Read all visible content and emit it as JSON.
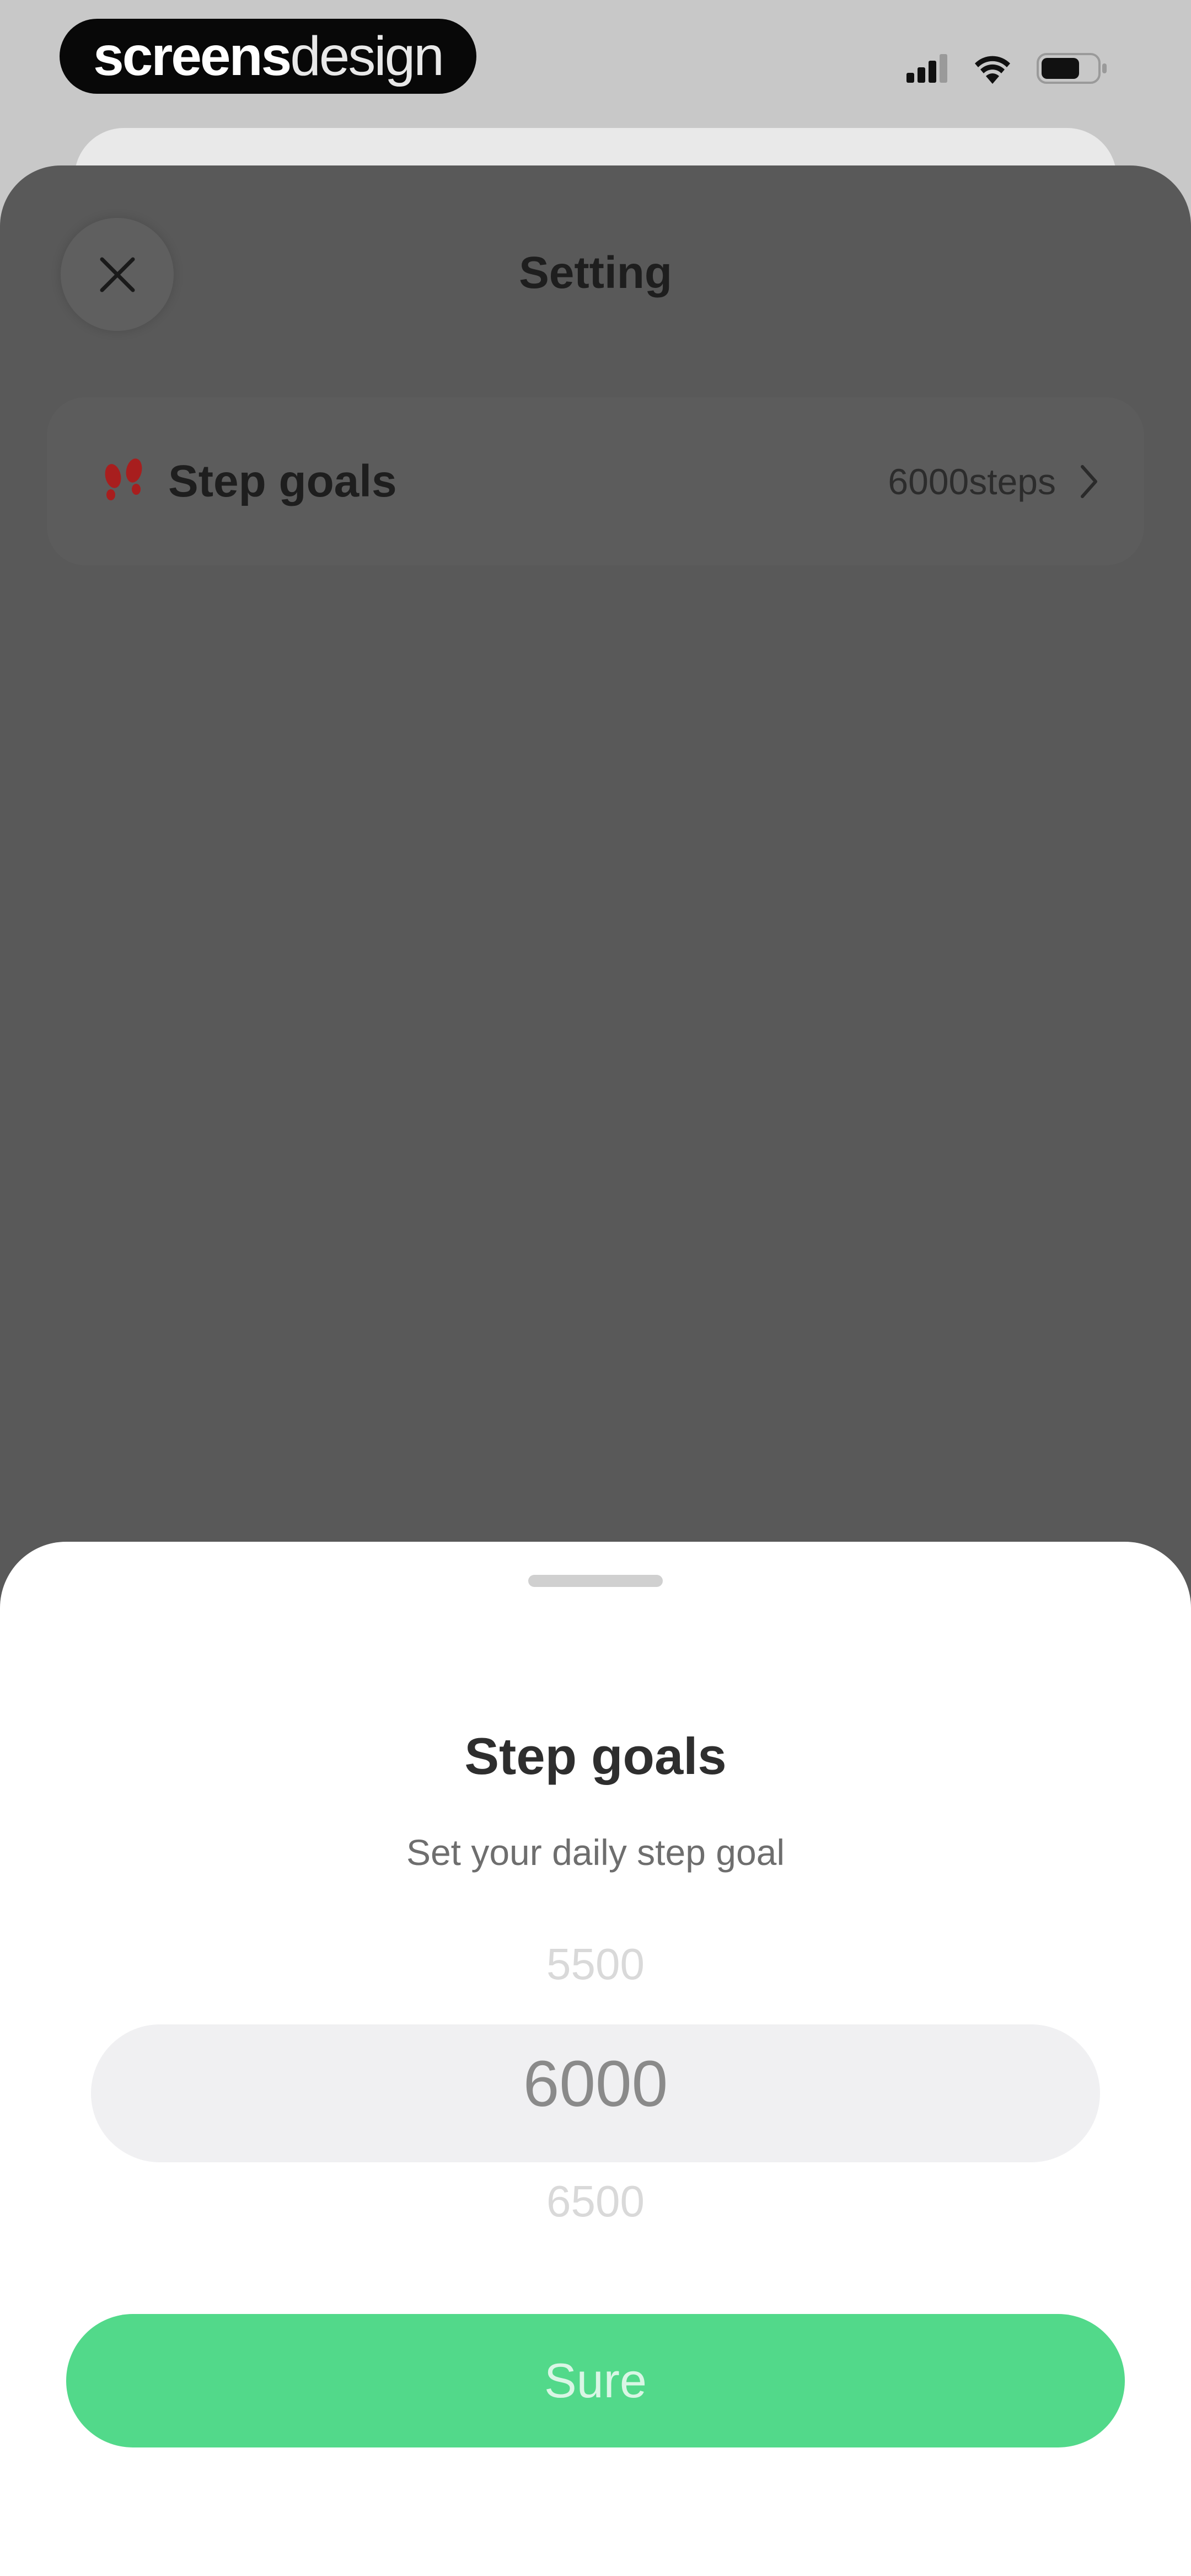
{
  "status_bar": {
    "brand_bold": "screens",
    "brand_light": "design",
    "icons": [
      "signal-icon",
      "wifi-icon",
      "battery-icon"
    ]
  },
  "header": {
    "title": "Setting",
    "close_icon": "close-icon"
  },
  "settings": {
    "step_goals": {
      "icon": "footprints-icon",
      "label": "Step goals",
      "value": "6000steps",
      "chevron": "chevron-right-icon"
    }
  },
  "bottom_sheet": {
    "title": "Step goals",
    "subtitle": "Set your daily step goal",
    "picker": {
      "previous": "5500",
      "selected": "6000",
      "next": "6500"
    },
    "confirm_label": "Sure"
  },
  "colors": {
    "accent": "#52d98a",
    "overlay": "#595959",
    "sheet": "#ffffff",
    "footprints": "#a81e1e"
  }
}
